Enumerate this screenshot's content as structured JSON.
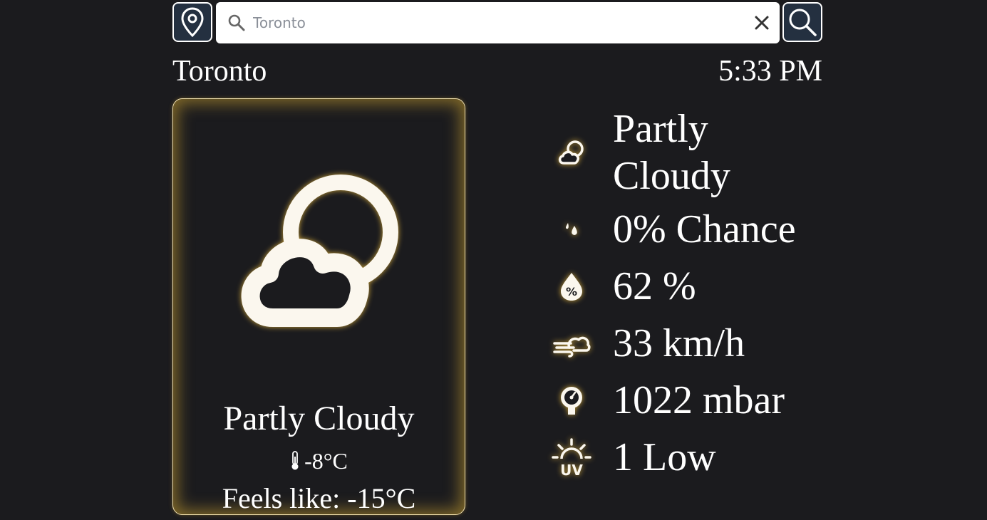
{
  "search": {
    "placeholder": "Toronto",
    "value": ""
  },
  "icons": {
    "location_button": "map-pin-icon",
    "search_input": "search-icon",
    "clear": "close-icon",
    "search_button": "search-icon"
  },
  "header": {
    "city": "Toronto",
    "time": "5:33 PM"
  },
  "current": {
    "icon": "partly-cloudy-icon",
    "condition": "Partly Cloudy",
    "temperature": "-8°C",
    "feels_like": "Feels like: -15°C"
  },
  "details": [
    {
      "icon": "partly-cloudy-icon",
      "line1": "Partly",
      "line2": "Cloudy"
    },
    {
      "icon": "rain-drops-icon",
      "value": "0% Chance"
    },
    {
      "icon": "humidity-icon",
      "value": "62 %"
    },
    {
      "icon": "wind-icon",
      "value": "33 km/h"
    },
    {
      "icon": "pressure-gauge-icon",
      "value": "1022 mbar"
    },
    {
      "icon": "uv-index-icon",
      "value": "1 Low"
    }
  ],
  "colors": {
    "background": "#1b1b1e",
    "text": "#ffffff",
    "glow": "#d6aa32",
    "button_bg": "#243040"
  }
}
